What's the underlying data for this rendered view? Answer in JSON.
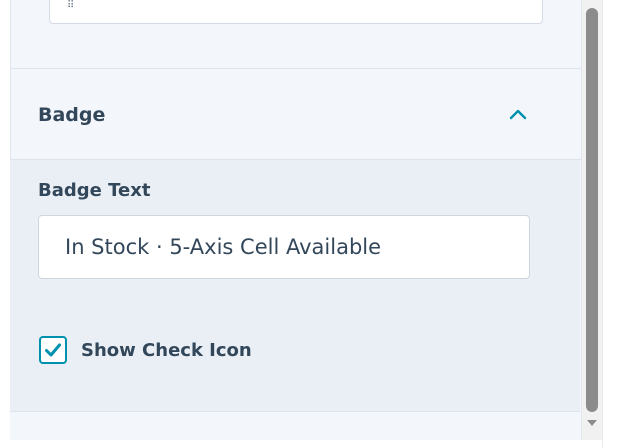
{
  "previous_field": {
    "grip_glyph": "⠿"
  },
  "badge_section": {
    "title": "Badge",
    "expanded": true,
    "badge_text_label": "Badge Text",
    "badge_text_value": "In Stock · 5-Axis Cell Available",
    "show_check_icon_label": "Show Check Icon",
    "show_check_icon_checked": true
  },
  "colors": {
    "accent": "#0091ae",
    "label_text": "#33475b",
    "panel_bg": "#f3f6fa",
    "section_body_bg": "#eaeff5"
  },
  "icons": {
    "chevron": "chevron-up-icon",
    "check": "check-icon",
    "scroll_down": "scroll-down-arrow-icon"
  }
}
